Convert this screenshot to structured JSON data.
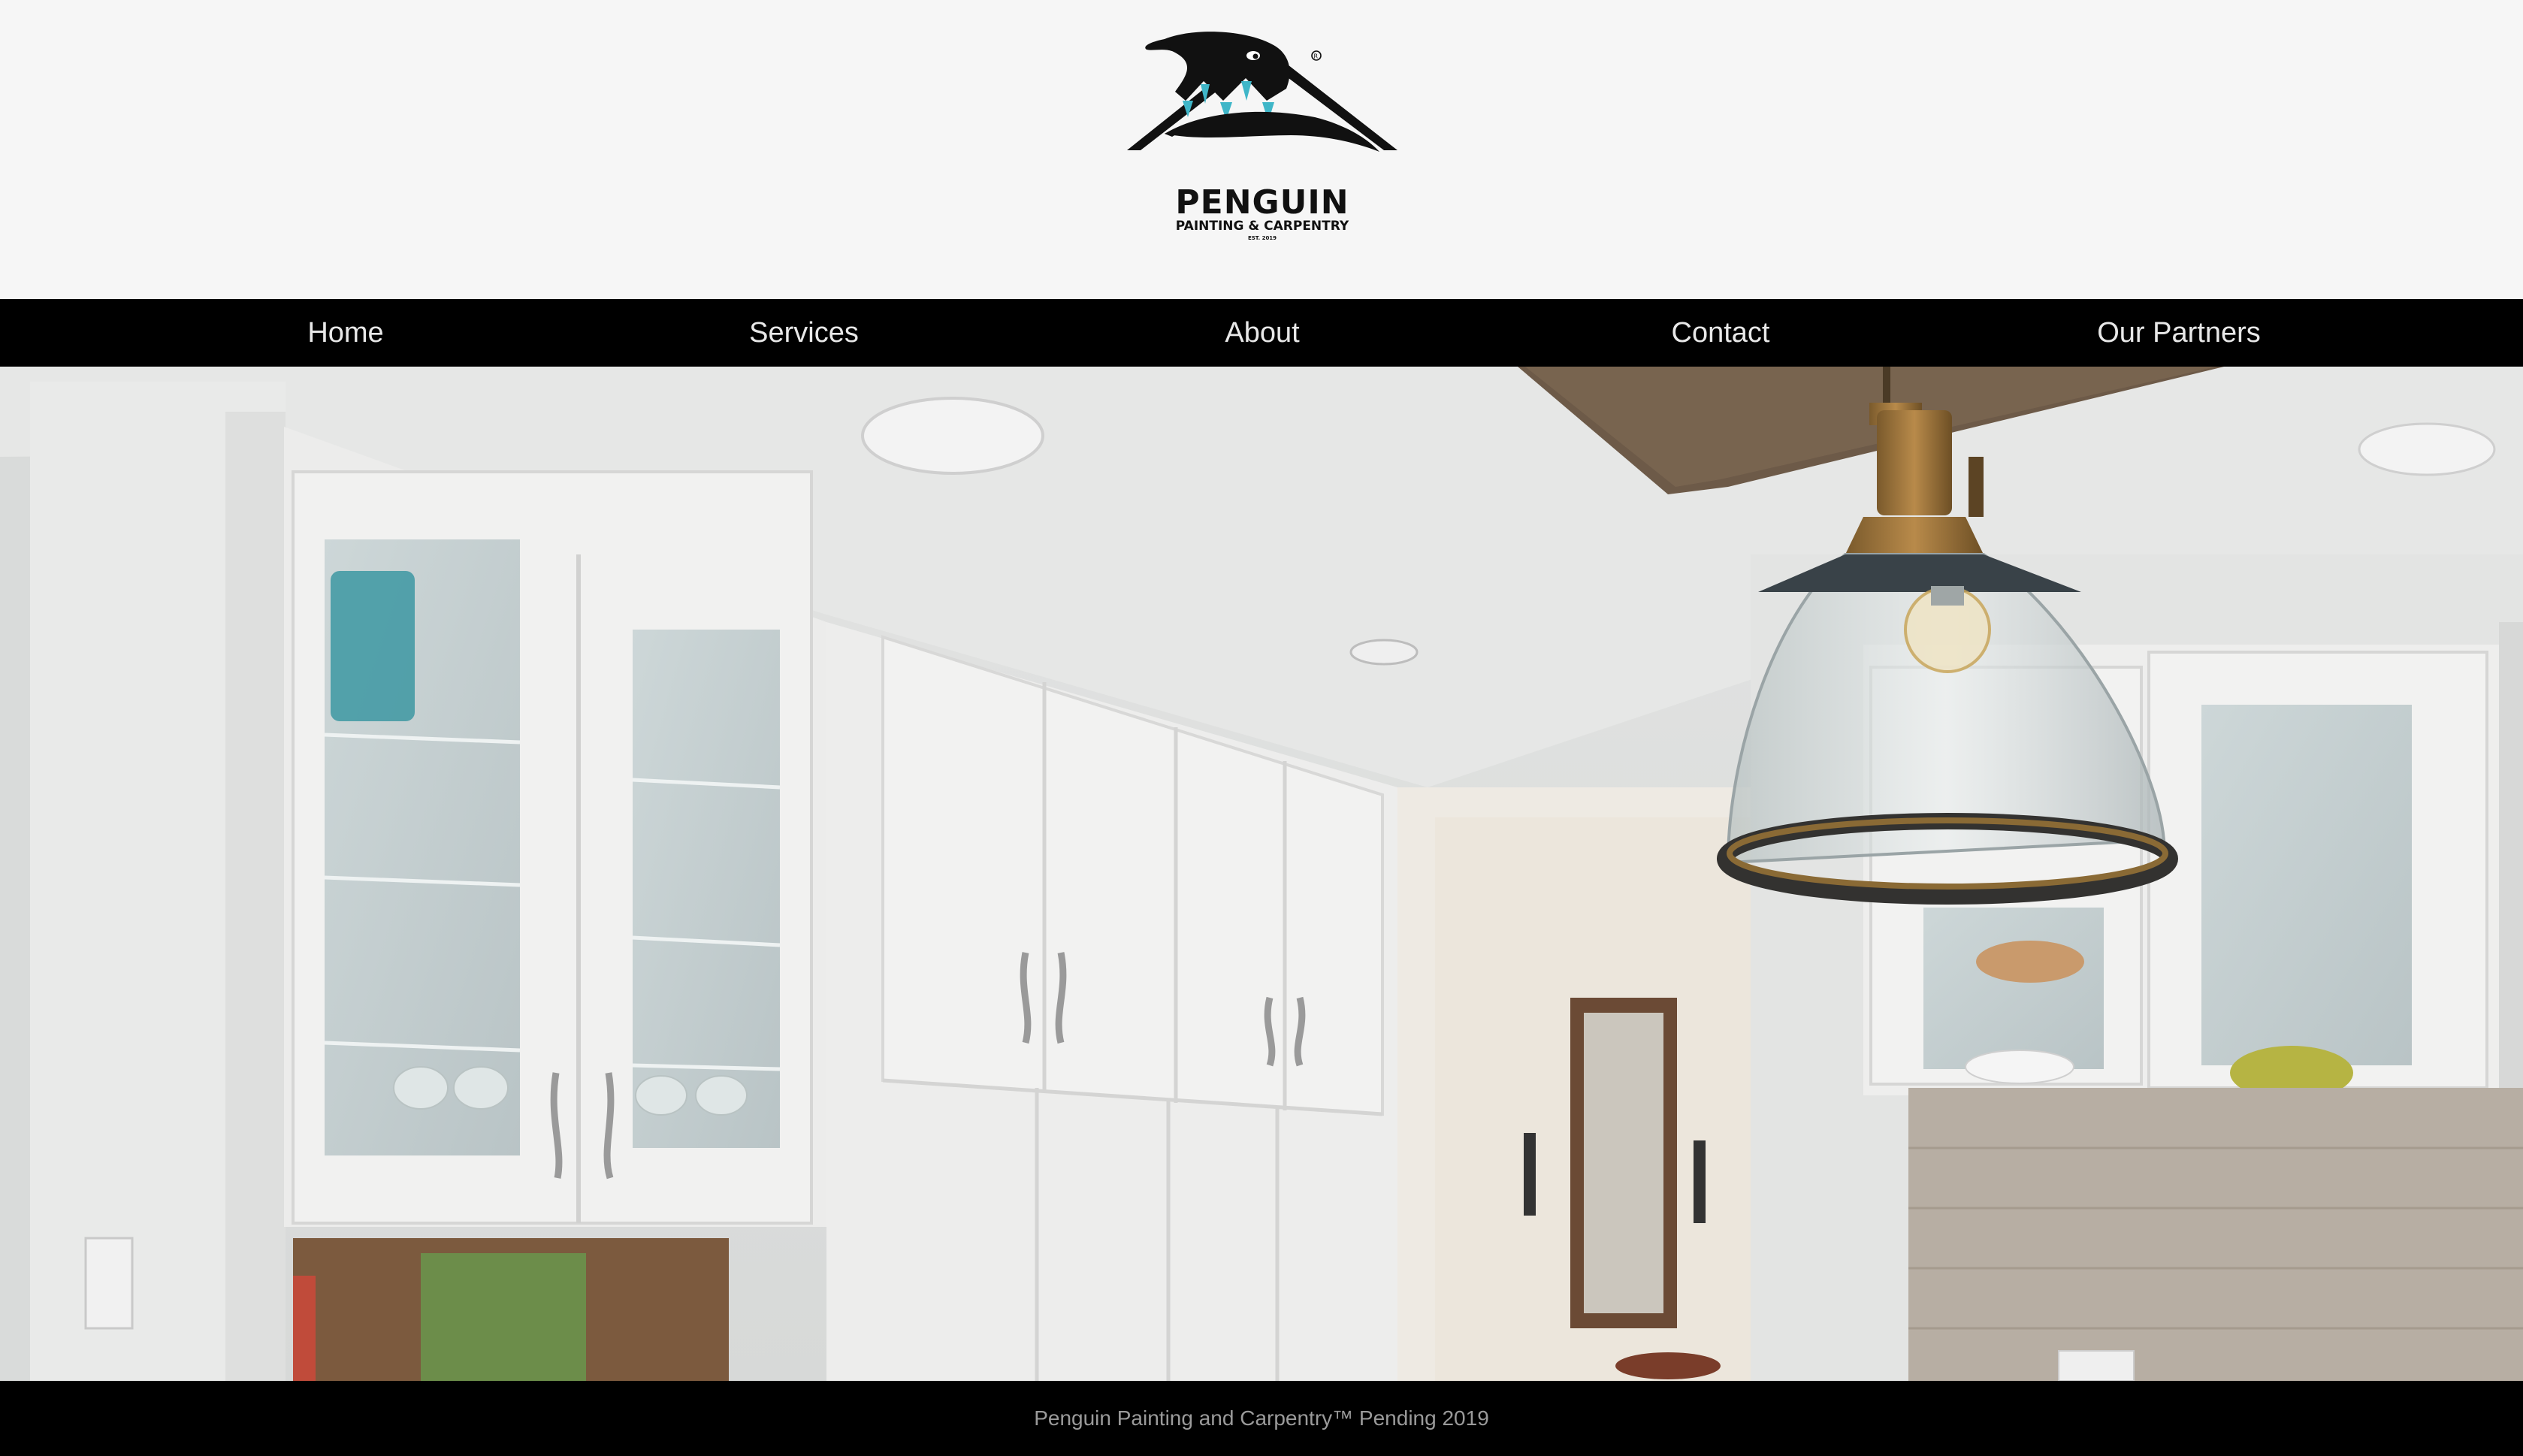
{
  "brand": {
    "name": "PENGUIN",
    "tagline": "PAINTING & CARPENTRY",
    "established": "EST. 2019"
  },
  "nav": {
    "items": [
      {
        "label": "Home"
      },
      {
        "label": "Services"
      },
      {
        "label": "About"
      },
      {
        "label": "Contact"
      },
      {
        "label": "Our Partners"
      }
    ]
  },
  "hero": {
    "icon": "kitchen-photo"
  },
  "footer": {
    "text": "Penguin Painting and Carpentry™ Pending 2019"
  },
  "colors": {
    "page_background": "#f6f6f6",
    "nav_background": "#000000",
    "nav_text": "#e8e8e8",
    "footer_text": "#9a9a9a",
    "logo_accent": "#3fb6c8"
  }
}
